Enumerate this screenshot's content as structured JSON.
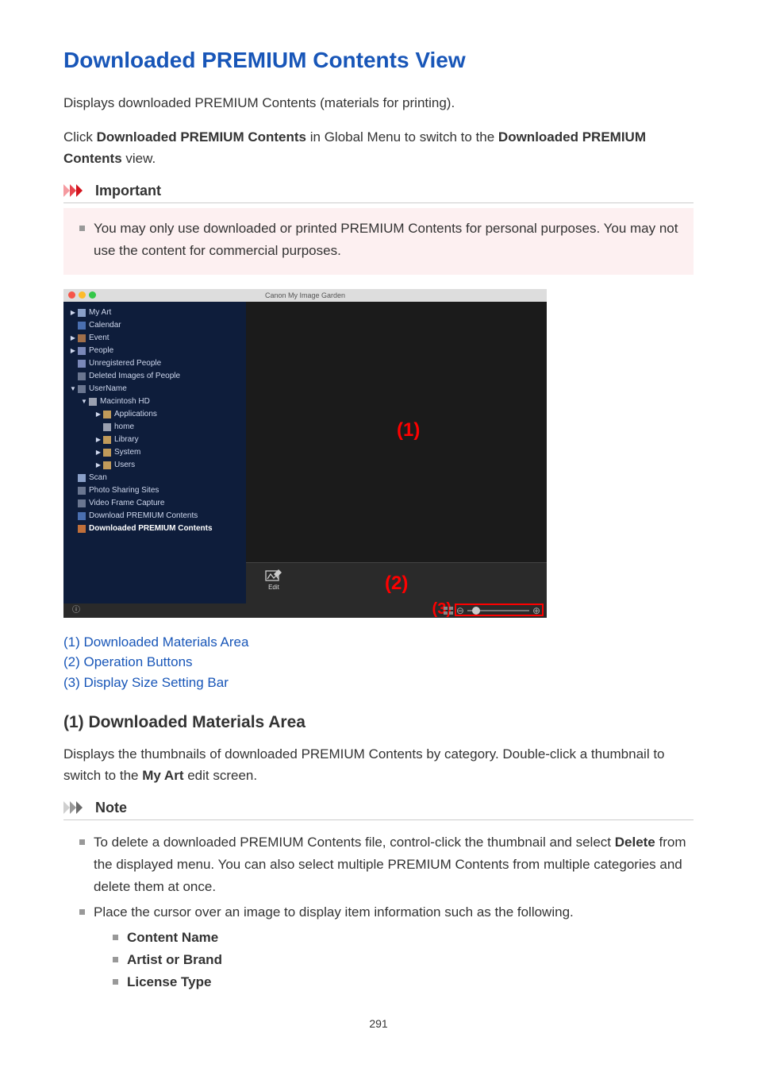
{
  "title": "Downloaded PREMIUM Contents View",
  "intro1": "Displays downloaded PREMIUM Contents (materials for printing).",
  "intro2a": "Click ",
  "intro2b": "Downloaded PREMIUM Contents",
  "intro2c": " in Global Menu to switch to the ",
  "intro2d": "Downloaded PREMIUM Contents",
  "intro2e": " view.",
  "important_label": "Important",
  "important_items": [
    "You may only use downloaded or printed PREMIUM Contents for personal purposes. You may not use the content for commercial purposes."
  ],
  "screenshot": {
    "window_title": "Canon My Image Garden",
    "tree": [
      {
        "lvl": 1,
        "caret": "▶",
        "icon": "#8aa0c8",
        "label": "My Art"
      },
      {
        "lvl": 1,
        "caret": "",
        "icon": "#4a6fb0",
        "label": "Calendar"
      },
      {
        "lvl": 1,
        "caret": "▶",
        "icon": "#a06f4a",
        "label": "Event"
      },
      {
        "lvl": 1,
        "caret": "▶",
        "icon": "#7a88b8",
        "label": "People"
      },
      {
        "lvl": 1,
        "caret": "",
        "icon": "#7a88b8",
        "label": "Unregistered People"
      },
      {
        "lvl": 1,
        "caret": "",
        "icon": "#6a7690",
        "label": "Deleted Images of People"
      },
      {
        "lvl": 1,
        "caret": "▼",
        "icon": "#6a7690",
        "label": "UserName"
      },
      {
        "lvl": 2,
        "caret": "▼",
        "icon": "#9aa0b0",
        "label": "Macintosh HD"
      },
      {
        "lvl": 3,
        "caret": "▶",
        "icon": "#c09a5a",
        "label": "Applications"
      },
      {
        "lvl": 3,
        "caret": "",
        "icon": "#9aa0b0",
        "label": "home"
      },
      {
        "lvl": 3,
        "caret": "▶",
        "icon": "#c09a5a",
        "label": "Library"
      },
      {
        "lvl": 3,
        "caret": "▶",
        "icon": "#c09a5a",
        "label": "System"
      },
      {
        "lvl": 3,
        "caret": "▶",
        "icon": "#c09a5a",
        "label": "Users"
      },
      {
        "lvl": 1,
        "caret": "",
        "icon": "#8aa0c8",
        "label": "Scan"
      },
      {
        "lvl": 1,
        "caret": "",
        "icon": "#6a7690",
        "label": "Photo Sharing Sites"
      },
      {
        "lvl": 1,
        "caret": "",
        "icon": "#6a7690",
        "label": "Video Frame Capture"
      },
      {
        "lvl": 1,
        "caret": "",
        "icon": "#4a6fb0",
        "label": "Download PREMIUM Contents"
      },
      {
        "lvl": 1,
        "caret": "",
        "icon": "#c06f3a",
        "label": "Downloaded PREMIUM Contents",
        "selected": true
      }
    ],
    "callouts": {
      "c1": "(1)",
      "c2": "(2)",
      "c3": "(3)"
    },
    "edit_label": "Edit"
  },
  "links": {
    "l1": "(1) Downloaded Materials Area",
    "l2": "(2) Operation Buttons",
    "l3": "(3) Display Size Setting Bar"
  },
  "section1": {
    "heading": "(1) Downloaded Materials Area",
    "para_a": "Displays the thumbnails of downloaded PREMIUM Contents by category. Double-click a thumbnail to switch to the ",
    "para_b": "My Art",
    "para_c": " edit screen."
  },
  "note_label": "Note",
  "note_items": {
    "n1a": "To delete a downloaded PREMIUM Contents file, control-click the thumbnail and select ",
    "n1b": "Delete",
    "n1c": " from the displayed menu. You can also select multiple PREMIUM Contents from multiple categories and delete them at once.",
    "n2": "Place the cursor over an image to display item information such as the following.",
    "sub": {
      "s1": "Content Name",
      "s2": "Artist or Brand",
      "s3": "License Type"
    }
  },
  "page_number": "291"
}
